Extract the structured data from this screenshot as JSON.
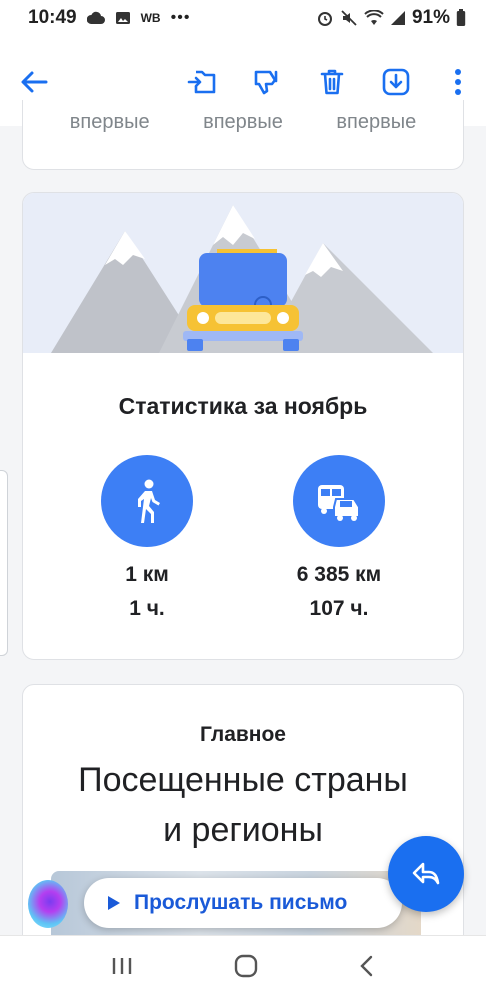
{
  "status_bar": {
    "time": "10:49",
    "carrier_badge": "WB",
    "battery": "91%"
  },
  "toolbar": {
    "icons": [
      "back-arrow-icon",
      "move-to-folder-icon",
      "dislike-icon",
      "delete-icon",
      "download-icon",
      "more-vertical-icon"
    ]
  },
  "first_card": {
    "labels": [
      "впервые",
      "впервые",
      "впервые"
    ]
  },
  "stats": {
    "title": "Статистика за ноябрь",
    "walk": {
      "distance": "1 км",
      "time": "1 ч."
    },
    "drive": {
      "distance": "6 385 км",
      "time": "107 ч."
    }
  },
  "main_card": {
    "label": "Главное",
    "title_line1": "Посещенные страны",
    "title_line2": "и регионы"
  },
  "listen": {
    "label": "Прослушать письмо"
  },
  "colors": {
    "accent": "#1a6ff0",
    "circle": "#3d7ff5",
    "car": "#4d82f0",
    "car_front": "#f6c234"
  }
}
